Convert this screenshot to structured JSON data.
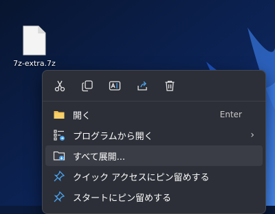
{
  "desktop": {
    "file_label": "7z-extra.7z"
  },
  "quick_actions": [
    {
      "name": "cut-button",
      "icon": "scissors-icon"
    },
    {
      "name": "copy-button",
      "icon": "copy-icon"
    },
    {
      "name": "rename-button",
      "icon": "rename-icon"
    },
    {
      "name": "share-button",
      "icon": "share-icon"
    },
    {
      "name": "delete-button",
      "icon": "trash-icon"
    }
  ],
  "menu": {
    "open": {
      "label": "開く",
      "shortcut": "Enter",
      "icon": "folder-icon"
    },
    "open_with": {
      "label": "プログラムから開く",
      "icon": "open-with-icon",
      "chevron": "›"
    },
    "extract_all": {
      "label": "すべて展開...",
      "icon": "extract-folder-icon"
    },
    "pin_quick_access": {
      "label": "クイック アクセスにピン留めする",
      "icon": "pin-icon"
    },
    "pin_start": {
      "label": "スタートにピン留めする",
      "icon": "pin-icon"
    }
  },
  "colors": {
    "menu_bg": "#2c2f37",
    "hover_bg": "#3a3d45",
    "accent": "#4aa3f0",
    "folder": "#f2c14e"
  }
}
